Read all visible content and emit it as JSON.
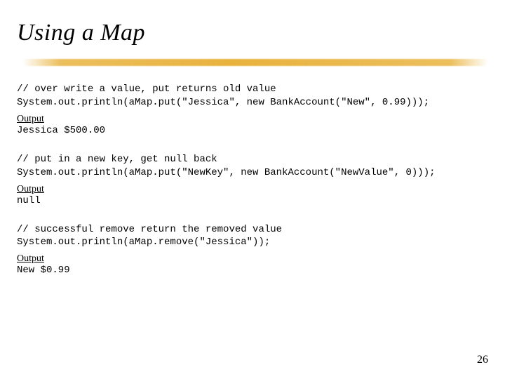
{
  "title": "Using a Map",
  "blocks": [
    {
      "comment": "// over write a value, put returns old value",
      "code": "System.out.println(aMap.put(\"Jessica\", new BankAccount(\"New\", 0.99)));",
      "output_label": "Output",
      "output": "Jessica $500.00"
    },
    {
      "comment": "// put in a new key, get null back",
      "code": "System.out.println(aMap.put(\"NewKey\", new BankAccount(\"NewValue\", 0)));",
      "output_label": "Output",
      "output": "null"
    },
    {
      "comment": "// successful remove return the removed value",
      "code": "System.out.println(aMap.remove(\"Jessica\"));",
      "output_label": "Output",
      "output": "New $0.99"
    }
  ],
  "page_number": "26"
}
